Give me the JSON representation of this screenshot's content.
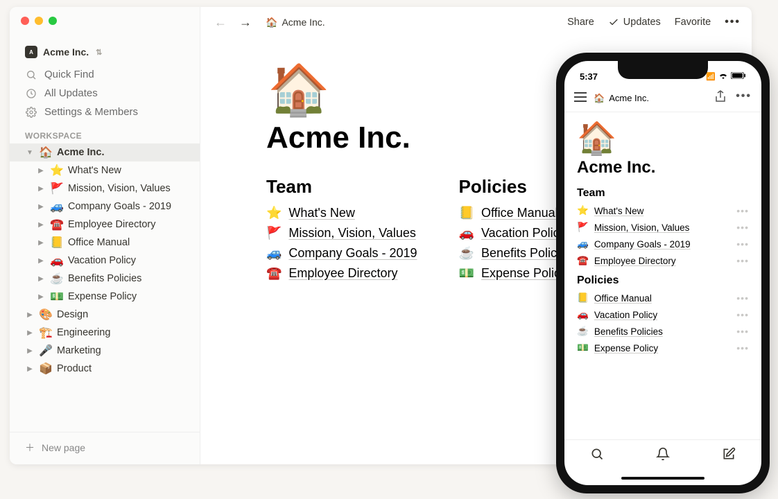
{
  "workspace": {
    "name": "Acme Inc.",
    "quick_find": "Quick Find",
    "all_updates": "All Updates",
    "settings": "Settings & Members",
    "section_label": "WORKSPACE",
    "new_page": "New page"
  },
  "tree": {
    "root": {
      "emoji": "🏠",
      "label": "Acme Inc."
    },
    "children": [
      {
        "emoji": "⭐",
        "label": "What's New"
      },
      {
        "emoji": "🚩",
        "label": "Mission, Vision, Values"
      },
      {
        "emoji": "🚙",
        "label": "Company Goals - 2019"
      },
      {
        "emoji": "☎️",
        "label": "Employee Directory"
      },
      {
        "emoji": "📒",
        "label": "Office Manual"
      },
      {
        "emoji": "🚗",
        "label": "Vacation Policy"
      },
      {
        "emoji": "☕",
        "label": "Benefits Policies"
      },
      {
        "emoji": "💵",
        "label": "Expense Policy"
      }
    ],
    "siblings": [
      {
        "emoji": "🎨",
        "label": "Design"
      },
      {
        "emoji": "🏗️",
        "label": "Engineering"
      },
      {
        "emoji": "🎤",
        "label": "Marketing"
      },
      {
        "emoji": "📦",
        "label": "Product"
      }
    ]
  },
  "topbar": {
    "breadcrumb_emoji": "🏠",
    "breadcrumb_label": "Acme Inc.",
    "share": "Share",
    "updates": "Updates",
    "favorite": "Favorite"
  },
  "page": {
    "hero_emoji": "🏠",
    "title": "Acme Inc.",
    "col1_heading": "Team",
    "col1_links": [
      {
        "emoji": "⭐",
        "label": "What's New"
      },
      {
        "emoji": "🚩",
        "label": "Mission, Vision, Values"
      },
      {
        "emoji": "🚙",
        "label": "Company Goals - 2019"
      },
      {
        "emoji": "☎️",
        "label": "Employee Directory"
      }
    ],
    "col2_heading": "Policies",
    "col2_links": [
      {
        "emoji": "📒",
        "label": "Office Manual"
      },
      {
        "emoji": "🚗",
        "label": "Vacation Policy"
      },
      {
        "emoji": "☕",
        "label": "Benefits Policies"
      },
      {
        "emoji": "💵",
        "label": "Expense Policy"
      }
    ]
  },
  "phone": {
    "time": "5:37",
    "breadcrumb_emoji": "🏠",
    "breadcrumb_label": "Acme Inc.",
    "hero_emoji": "🏠",
    "title": "Acme Inc.",
    "section1": "Team",
    "links1": [
      {
        "emoji": "⭐",
        "label": "What's New"
      },
      {
        "emoji": "🚩",
        "label": "Mission, Vision, Values"
      },
      {
        "emoji": "🚙",
        "label": "Company Goals - 2019"
      },
      {
        "emoji": "☎️",
        "label": "Employee Directory"
      }
    ],
    "section2": "Policies",
    "links2": [
      {
        "emoji": "📒",
        "label": "Office Manual"
      },
      {
        "emoji": "🚗",
        "label": "Vacation Policy"
      },
      {
        "emoji": "☕",
        "label": "Benefits Policies"
      },
      {
        "emoji": "💵",
        "label": "Expense Policy"
      }
    ]
  }
}
